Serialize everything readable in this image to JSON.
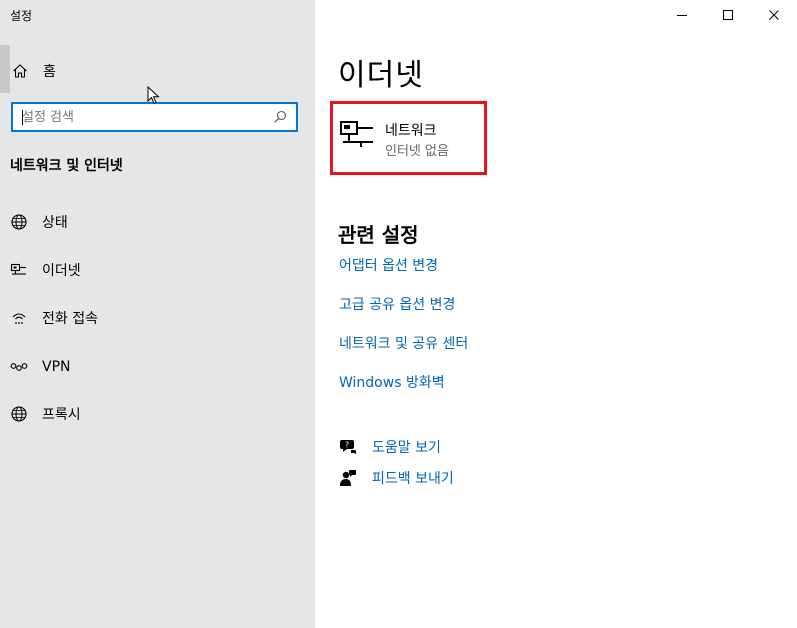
{
  "app": {
    "title": "설정"
  },
  "window_controls": {
    "minimize_icon": "minimize-icon",
    "maximize_icon": "maximize-icon",
    "close_icon": "close-icon"
  },
  "sidebar": {
    "home_label": "홈",
    "search": {
      "value": "",
      "placeholder": "설정 검색"
    },
    "section_heading": "네트워크 및 인터넷",
    "items": [
      {
        "label": "상태",
        "icon": "globe-status-icon"
      },
      {
        "label": "이더넷",
        "icon": "ethernet-icon"
      },
      {
        "label": "전화 접속",
        "icon": "dialup-icon"
      },
      {
        "label": "VPN",
        "icon": "vpn-icon"
      },
      {
        "label": "프록시",
        "icon": "globe-icon"
      }
    ]
  },
  "main": {
    "title": "이더넷",
    "network": {
      "name": "네트워크",
      "status": "인터넷 없음",
      "highlight_color": "#e81123"
    },
    "related_heading": "관련 설정",
    "related_links": [
      "어댑터 옵션 변경",
      "고급 공유 옵션 변경",
      "네트워크 및 공유 센터",
      "Windows 방화벽"
    ],
    "help": [
      {
        "label": "도움말 보기",
        "icon": "help-chat-icon"
      },
      {
        "label": "피드백 보내기",
        "icon": "feedback-icon"
      }
    ]
  },
  "colors": {
    "accent": "#0078d7",
    "link": "#0066b4",
    "sidebar_bg": "#e6e6e6"
  }
}
